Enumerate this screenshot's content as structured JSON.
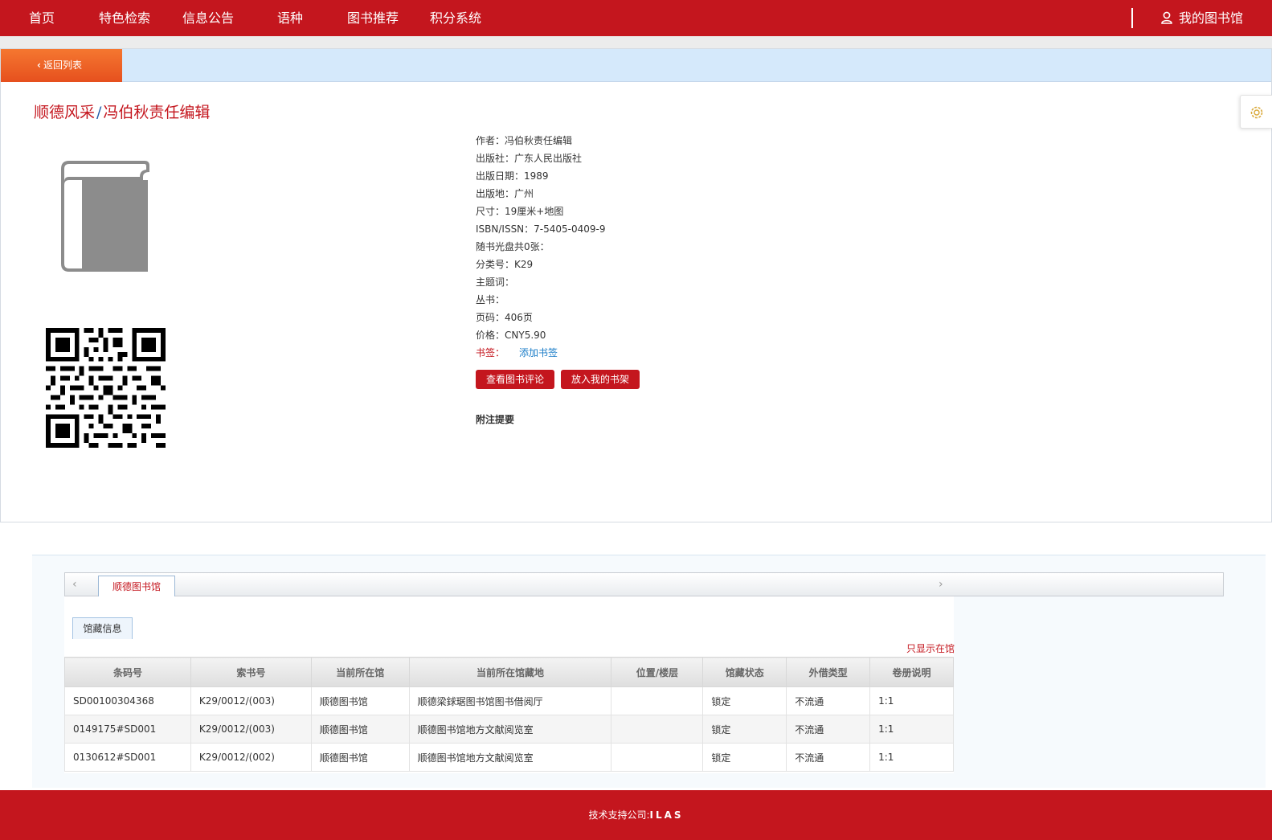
{
  "nav": {
    "items": [
      "首页",
      "特色检索",
      "信息公告",
      "语种",
      "图书推荐",
      "积分系统"
    ],
    "my_library": "我的图书馆"
  },
  "detail": {
    "back_label": "返回列表",
    "title_main": "顺德风采",
    "title_sep": "/",
    "title_resp": "冯伯秋责任编辑",
    "meta": [
      {
        "label": "作者：",
        "value": "冯伯秋责任编辑"
      },
      {
        "label": "出版社：",
        "value": "广东人民出版社"
      },
      {
        "label": "出版日期：",
        "value": "1989"
      },
      {
        "label": "出版地：",
        "value": "广州"
      },
      {
        "label": "尺寸：",
        "value": "19厘米+地图"
      },
      {
        "label": "ISBN/ISSN：",
        "value": "7-5405-0409-9"
      },
      {
        "label": "随书光盘共0张：",
        "value": ""
      },
      {
        "label": "分类号：",
        "value": "K29"
      },
      {
        "label": "主题词：",
        "value": ""
      },
      {
        "label": "丛书：",
        "value": ""
      },
      {
        "label": "页码：",
        "value": "406页"
      },
      {
        "label": "价格：",
        "value": "CNY5.90"
      }
    ],
    "bookmark_label": "书签：",
    "bookmark_add": "添加书签",
    "btn_review": "查看图书评论",
    "btn_shelf": "放入我的书架",
    "note_heading": "附注提要"
  },
  "holdings": {
    "library_tab": "顺德图书馆",
    "sub_tab": "馆藏信息",
    "only_in_library": "只显示在馆",
    "columns": [
      "条码号",
      "索书号",
      "当前所在馆",
      "当前所在馆藏地",
      "位置/楼层",
      "馆藏状态",
      "外借类型",
      "卷册说明"
    ],
    "rows": [
      [
        "SD00100304368",
        "K29/0012/(003)",
        "顺德图书馆",
        "顺德梁銶琚图书馆图书借阅厅",
        "",
        "锁定",
        "不流通",
        "1:1"
      ],
      [
        "0149175#SD001",
        "K29/0012/(003)",
        "顺德图书馆",
        "顺德图书馆地方文献阅览室",
        "",
        "锁定",
        "不流通",
        "1:1"
      ],
      [
        "0130612#SD001",
        "K29/0012/(002)",
        "顺德图书馆",
        "顺德图书馆地方文献阅览室",
        "",
        "锁定",
        "不流通",
        "1:1"
      ]
    ]
  },
  "footer": {
    "label": "技术支持公司:",
    "company": "ILAS"
  },
  "colors": {
    "brand_red": "#c4161e",
    "back_orange": "#f06a28",
    "back_bar_blue": "#d5e9fb",
    "link_blue": "#1d7ec8"
  },
  "icons": [
    "chevron-left-icon",
    "user-icon",
    "book-icon",
    "qr-code",
    "settings-icon",
    "chevron-left-icon",
    "chevron-right-icon"
  ]
}
